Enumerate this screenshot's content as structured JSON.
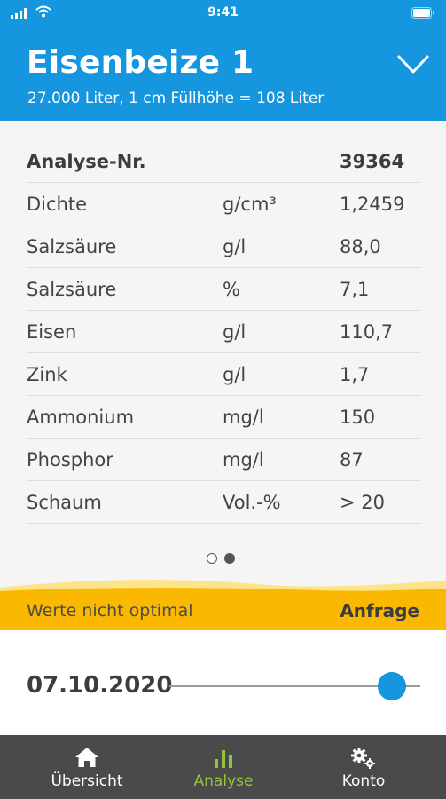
{
  "status_bar": {
    "time": "9:41"
  },
  "header": {
    "title": "Eisenbeize 1",
    "subtitle": "27.000 Liter, 1 cm Füllhöhe = 108 Liter"
  },
  "analysis": {
    "header": {
      "label": "Analyse-Nr.",
      "value": "39364"
    },
    "rows": [
      {
        "name": "Dichte",
        "unit": "g/cm³",
        "value": "1,2459"
      },
      {
        "name": "Salzsäure",
        "unit": "g/l",
        "value": "88,0"
      },
      {
        "name": "Salzsäure",
        "unit": "%",
        "value": "7,1"
      },
      {
        "name": "Eisen",
        "unit": "g/l",
        "value": "110,7"
      },
      {
        "name": "Zink",
        "unit": "g/l",
        "value": "1,7"
      },
      {
        "name": "Ammonium",
        "unit": "mg/l",
        "value": "150"
      },
      {
        "name": "Phosphor",
        "unit": "mg/l",
        "value": "87"
      },
      {
        "name": "Schaum",
        "unit": "Vol.-%",
        "value": "> 20"
      }
    ]
  },
  "pager": {
    "pages": 2,
    "current": 2
  },
  "warning": {
    "text": "Werte nicht optimal",
    "action": "Anfrage"
  },
  "date_slider": {
    "date": "07.10.2020",
    "position": 0.9
  },
  "tabs": [
    {
      "label": "Übersicht",
      "icon": "home-icon",
      "active": false
    },
    {
      "label": "Analyse",
      "icon": "bar-chart-icon",
      "active": true
    },
    {
      "label": "Konto",
      "icon": "gears-icon",
      "active": false
    }
  ],
  "colors": {
    "header_blue": "#1596de",
    "warning_yellow": "#fab900",
    "active_tab_green": "#8dc63f",
    "tabbar_gray": "#4a4a4a"
  }
}
